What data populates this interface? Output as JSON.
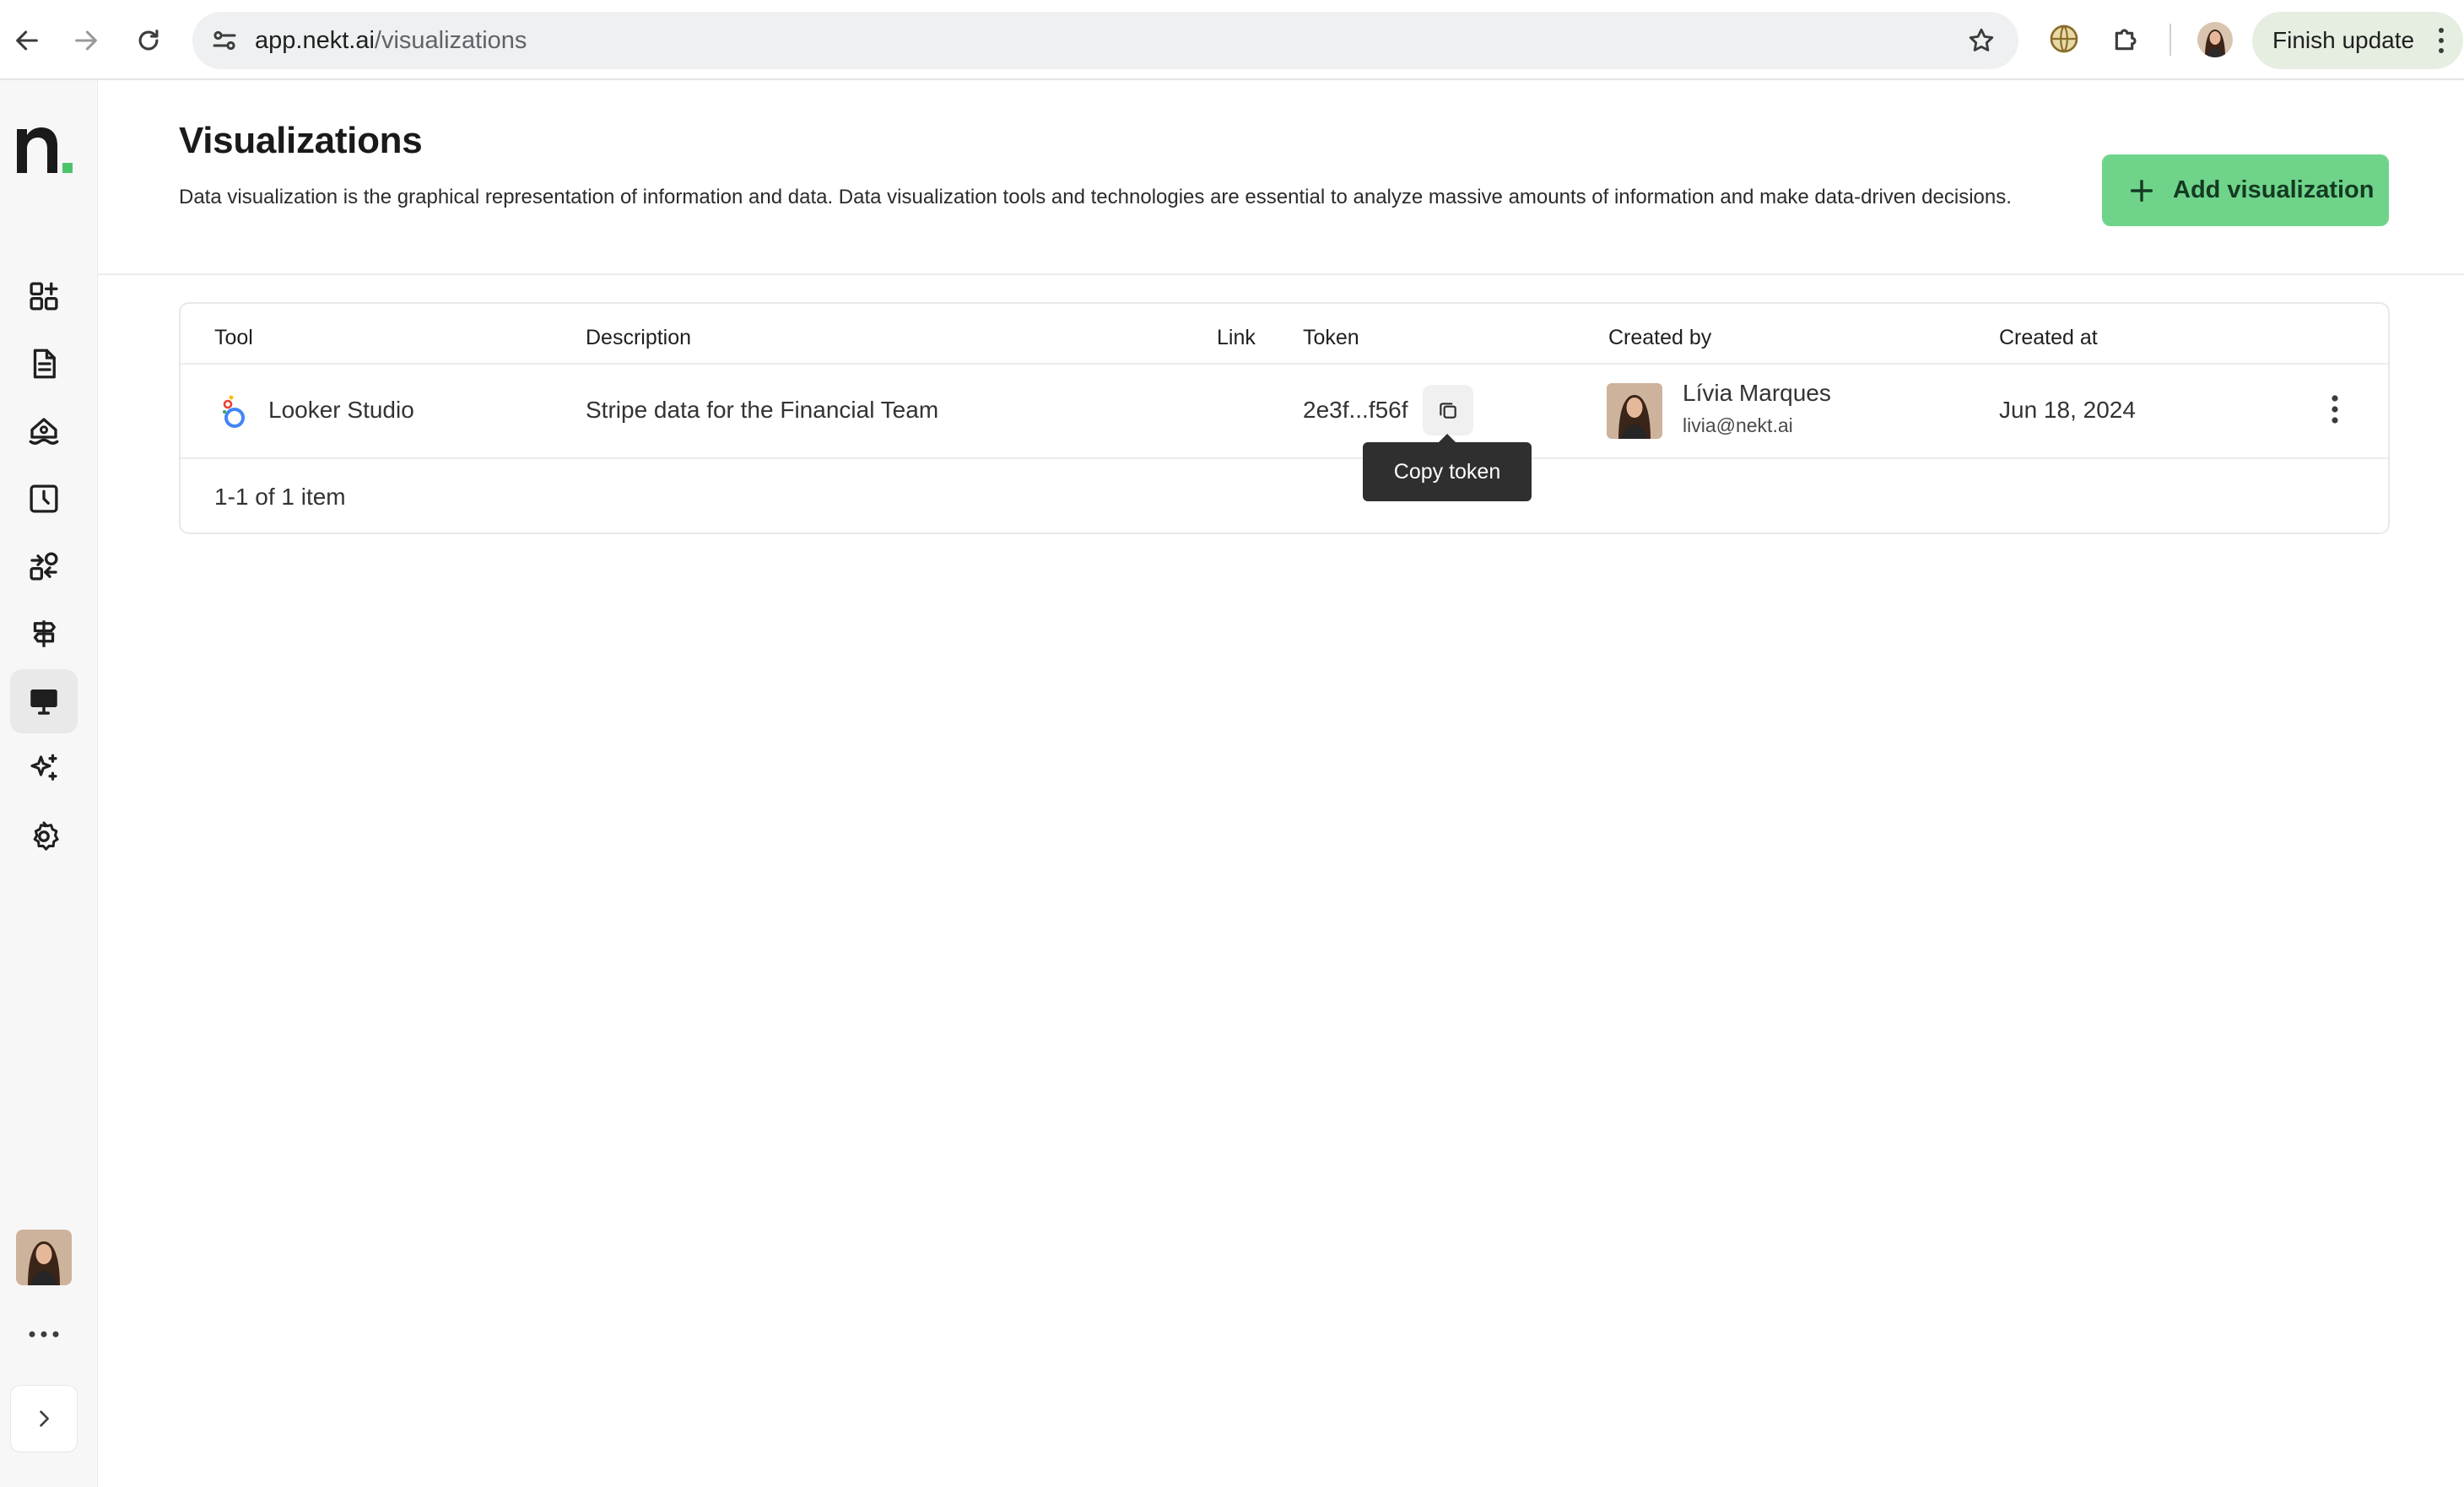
{
  "browser": {
    "url_host": "app.nekt.ai",
    "url_path": "/visualizations",
    "finish_update_label": "Finish update"
  },
  "sidebar": {
    "items": [
      {
        "name": "dashboard-add-icon"
      },
      {
        "name": "document-icon"
      },
      {
        "name": "lakehouse-icon"
      },
      {
        "name": "clock-history-icon"
      },
      {
        "name": "transformations-icon"
      },
      {
        "name": "signpost-icon"
      },
      {
        "name": "monitor-icon",
        "active": true
      },
      {
        "name": "sparkles-ai-icon"
      },
      {
        "name": "settings-gear-icon"
      }
    ]
  },
  "page": {
    "title": "Visualizations",
    "description": "Data visualization is the graphical representation of information and data. Data visualization tools and technologies are essential to analyze massive amounts of information and make data-driven decisions.",
    "add_button_label": "Add visualization"
  },
  "table": {
    "columns": [
      "Tool",
      "Description",
      "Link",
      "Token",
      "Created by",
      "Created at"
    ],
    "rows": [
      {
        "tool": "Looker Studio",
        "description": "Stripe data for the Financial Team",
        "link": "",
        "token": "2e3f...f56f",
        "created_by_name": "Lívia Marques",
        "created_by_email": "livia@nekt.ai",
        "created_at": "Jun 18, 2024"
      }
    ],
    "pagination": "1-1 of 1 item"
  },
  "tooltip": {
    "text": "Copy token"
  },
  "colors": {
    "accent_green": "#6fd48a",
    "active_sidebar_bg": "#e9e9e9",
    "tooltip_bg": "#2f2f2f"
  }
}
